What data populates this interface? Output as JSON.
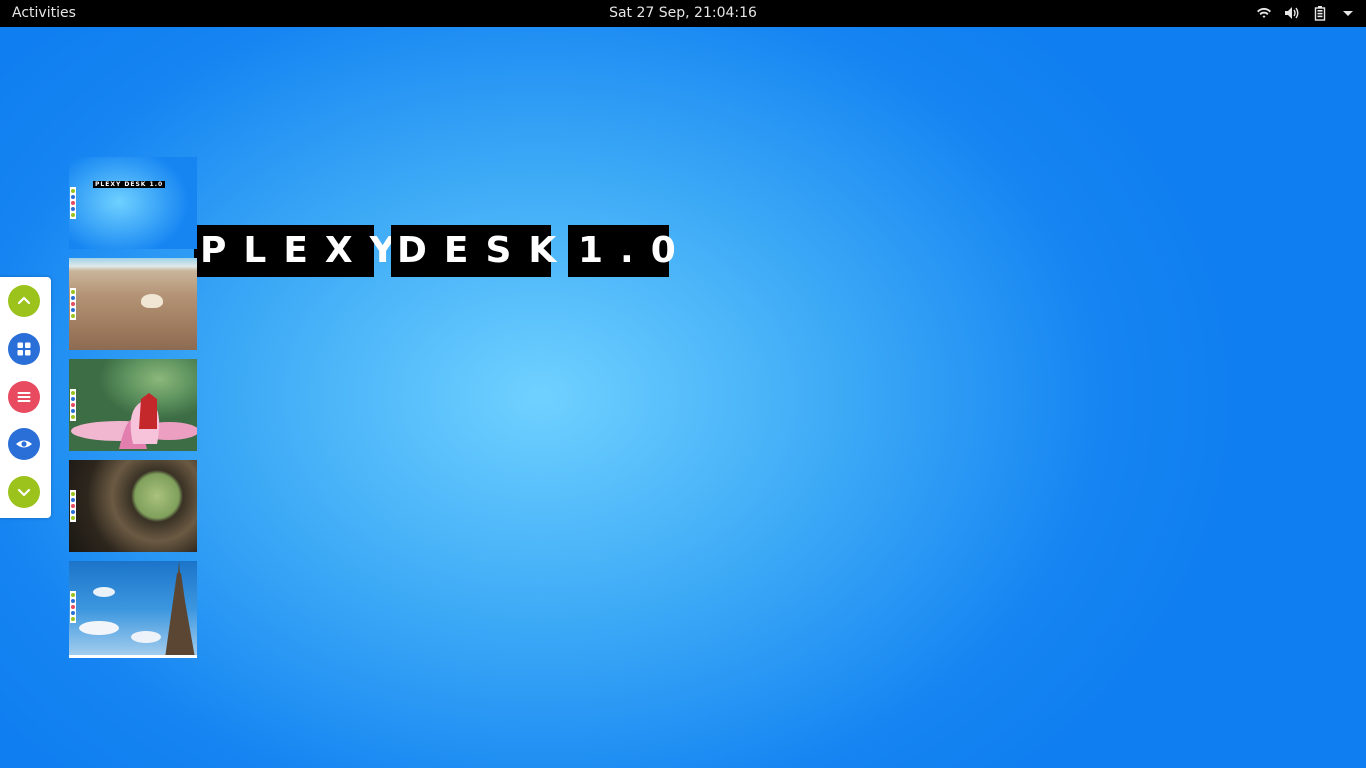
{
  "topbar": {
    "activities_label": "Activities",
    "clock": "Sat 27 Sep, 21:04:16",
    "tray_icons": [
      "wifi-icon",
      "volume-icon",
      "battery-icon",
      "chevron-down-icon"
    ]
  },
  "desktop": {
    "title_words": [
      "PLEXY",
      "DESK",
      "1.0"
    ],
    "thumb_title": "PLEXY DESK 1.0"
  },
  "dock": {
    "buttons": [
      {
        "name": "scroll-up-button",
        "icon": "chevron-up-icon",
        "color": "#9bc31c"
      },
      {
        "name": "grid-button",
        "icon": "grid-icon",
        "color": "#2a6fd8"
      },
      {
        "name": "menu-button",
        "icon": "hamburger-icon",
        "color": "#e84a5f"
      },
      {
        "name": "preview-button",
        "icon": "eye-icon",
        "color": "#2a6fd8"
      },
      {
        "name": "scroll-down-button",
        "icon": "chevron-down-icon",
        "color": "#9bc31c"
      }
    ]
  },
  "workspaces": [
    {
      "name": "workspace-plexydesk",
      "wallpaper": "blue gradient"
    },
    {
      "name": "workspace-beach",
      "wallpaper": "sand and shell"
    },
    {
      "name": "workspace-lotus",
      "wallpaper": "pink lotus flower"
    },
    {
      "name": "workspace-tunnel",
      "wallpaper": "wooden tunnel"
    },
    {
      "name": "workspace-eiffel",
      "wallpaper": "eiffel tower sky"
    }
  ],
  "colors": {
    "accent_green": "#9bc31c",
    "accent_blue": "#2a6fd8",
    "accent_red": "#e84a5f",
    "desktop_center": "#6fd1ff",
    "desktop_edge": "#0f7ef0"
  }
}
